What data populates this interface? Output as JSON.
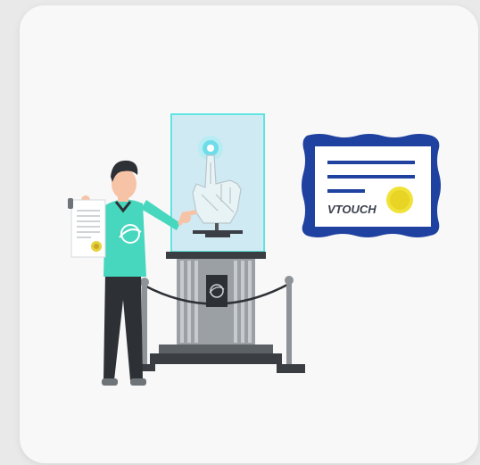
{
  "certificate": {
    "brand": "VTOUCH"
  }
}
